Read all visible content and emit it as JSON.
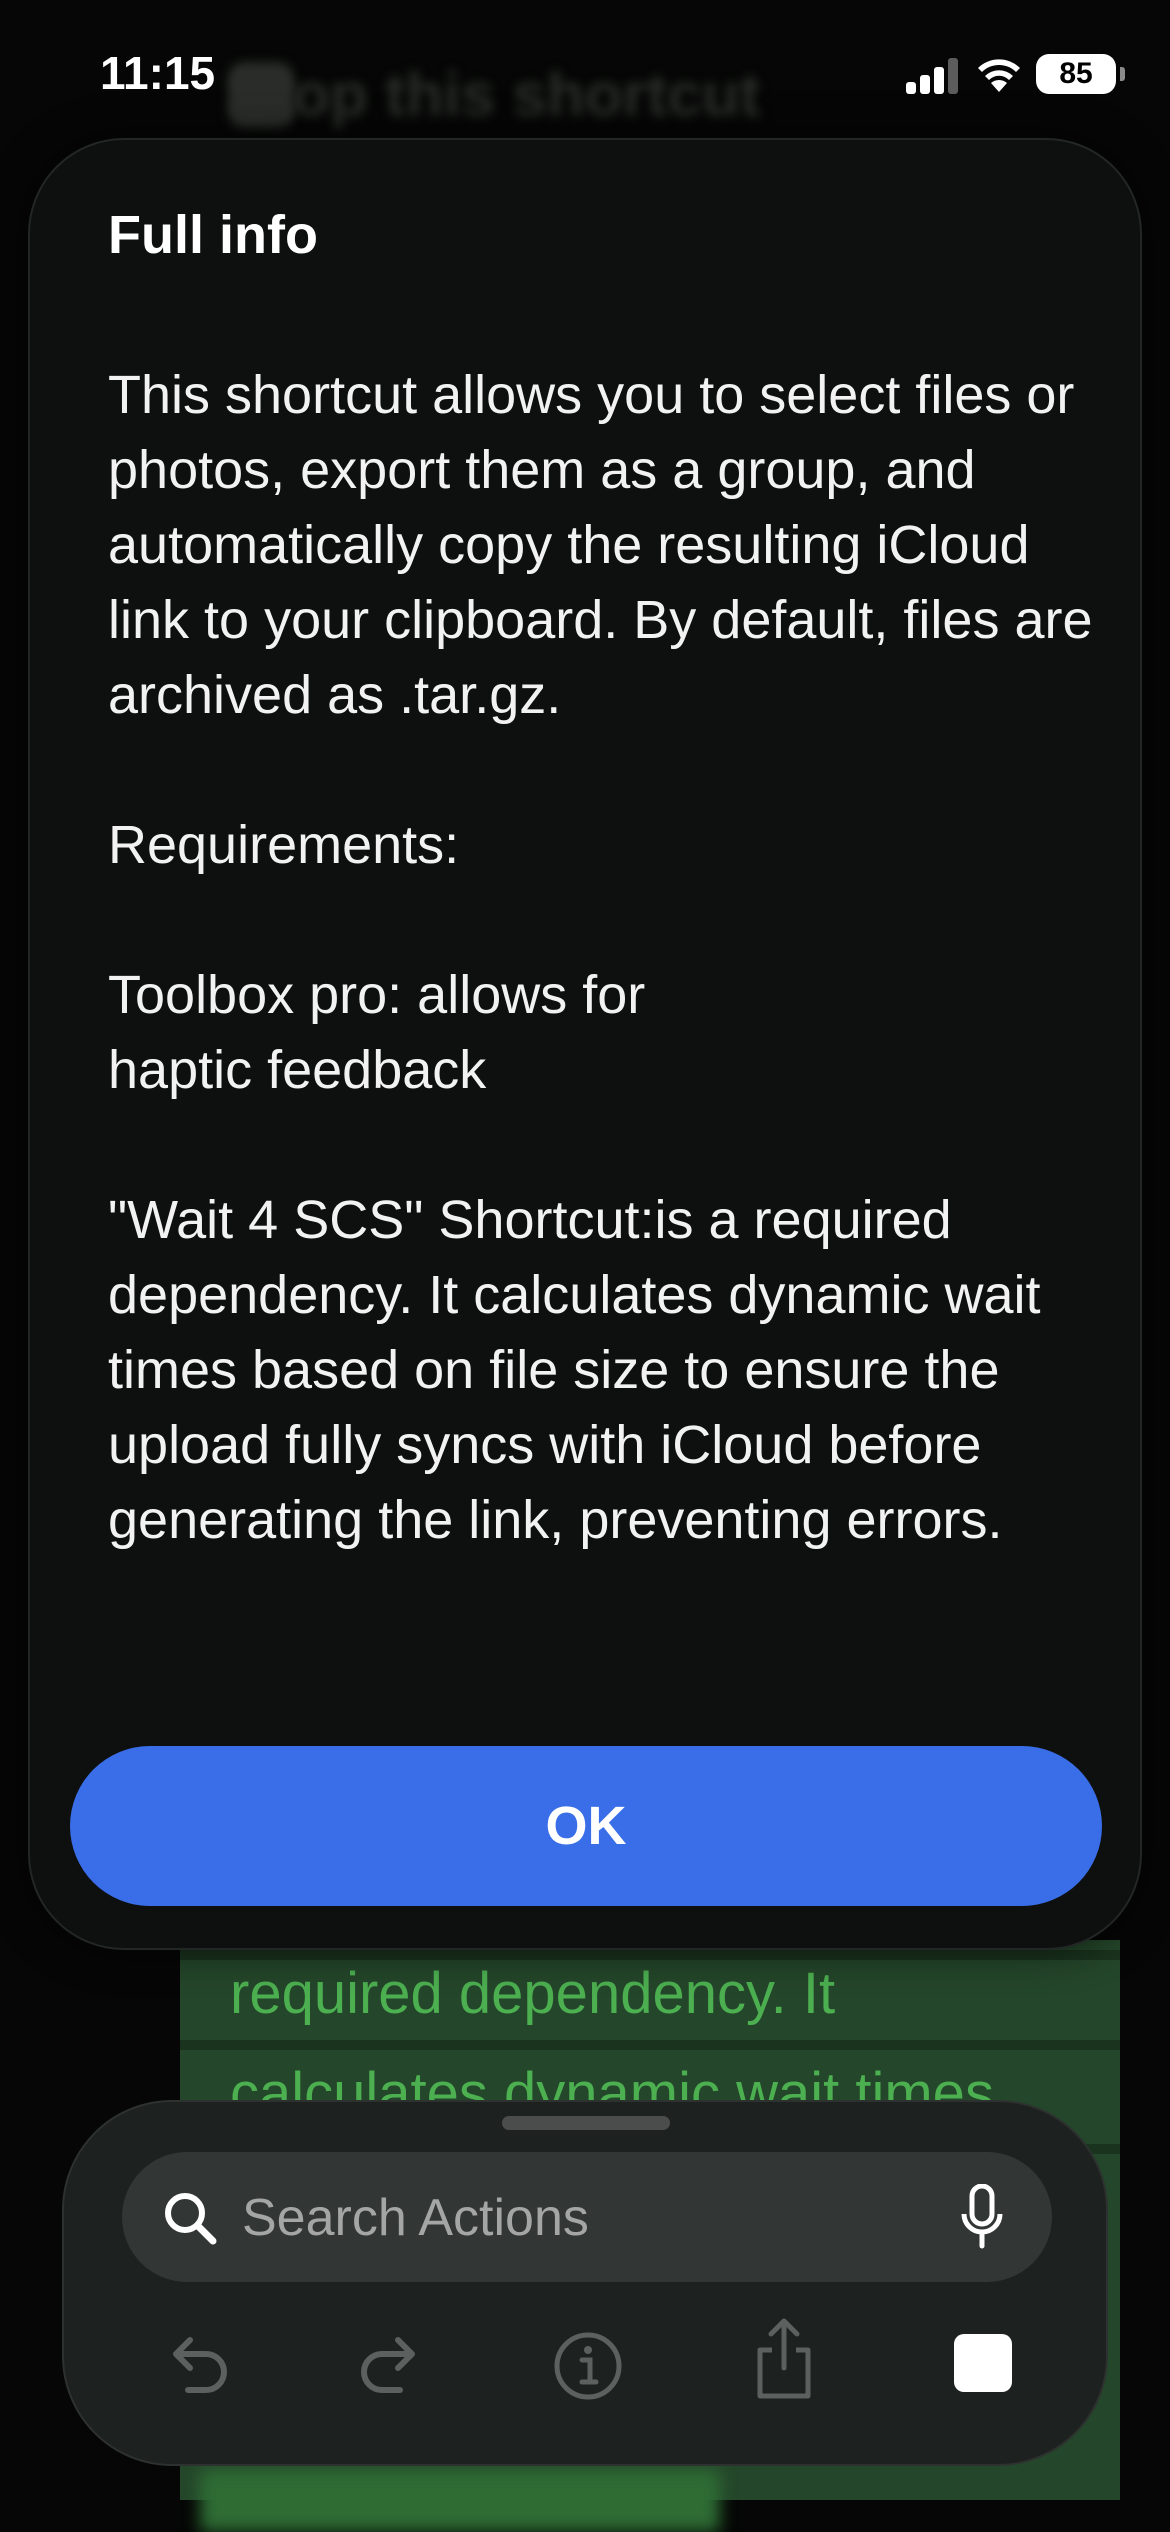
{
  "status_bar": {
    "time": "11:15",
    "battery": "85"
  },
  "background": {
    "title": "Stop this shortcut",
    "text_line_1": "required dependency. It",
    "text_line_2": "calculates dynamic wait times"
  },
  "dialog": {
    "title": "Full info",
    "body": "This shortcut allows you to select files or photos, export them as a group, and automatically copy the resulting iCloud link to your clipboard. By default, files are archived as .tar.gz.\n\nRequirements:\n\nToolbox pro: allows for\nhaptic feedback\n\n\"Wait 4 SCS\" Shortcut:is a required dependency. It calculates dynamic wait times based on file size to ensure the upload fully syncs with iCloud before generating the link, preventing errors.",
    "ok_label": "OK"
  },
  "action_panel": {
    "search_placeholder": "Search Actions"
  },
  "icons": {
    "search": "search-icon",
    "mic": "mic-icon",
    "undo": "undo-icon",
    "redo": "redo-icon",
    "info": "info-icon",
    "share": "share-icon",
    "stop": "stop-icon"
  },
  "colors": {
    "accent": "#3a6ee8",
    "dialog_bg": "#0d100e",
    "panel_bg": "#1d211f",
    "bg_green": "#24462a",
    "bg_text_green": "#4caf50"
  }
}
